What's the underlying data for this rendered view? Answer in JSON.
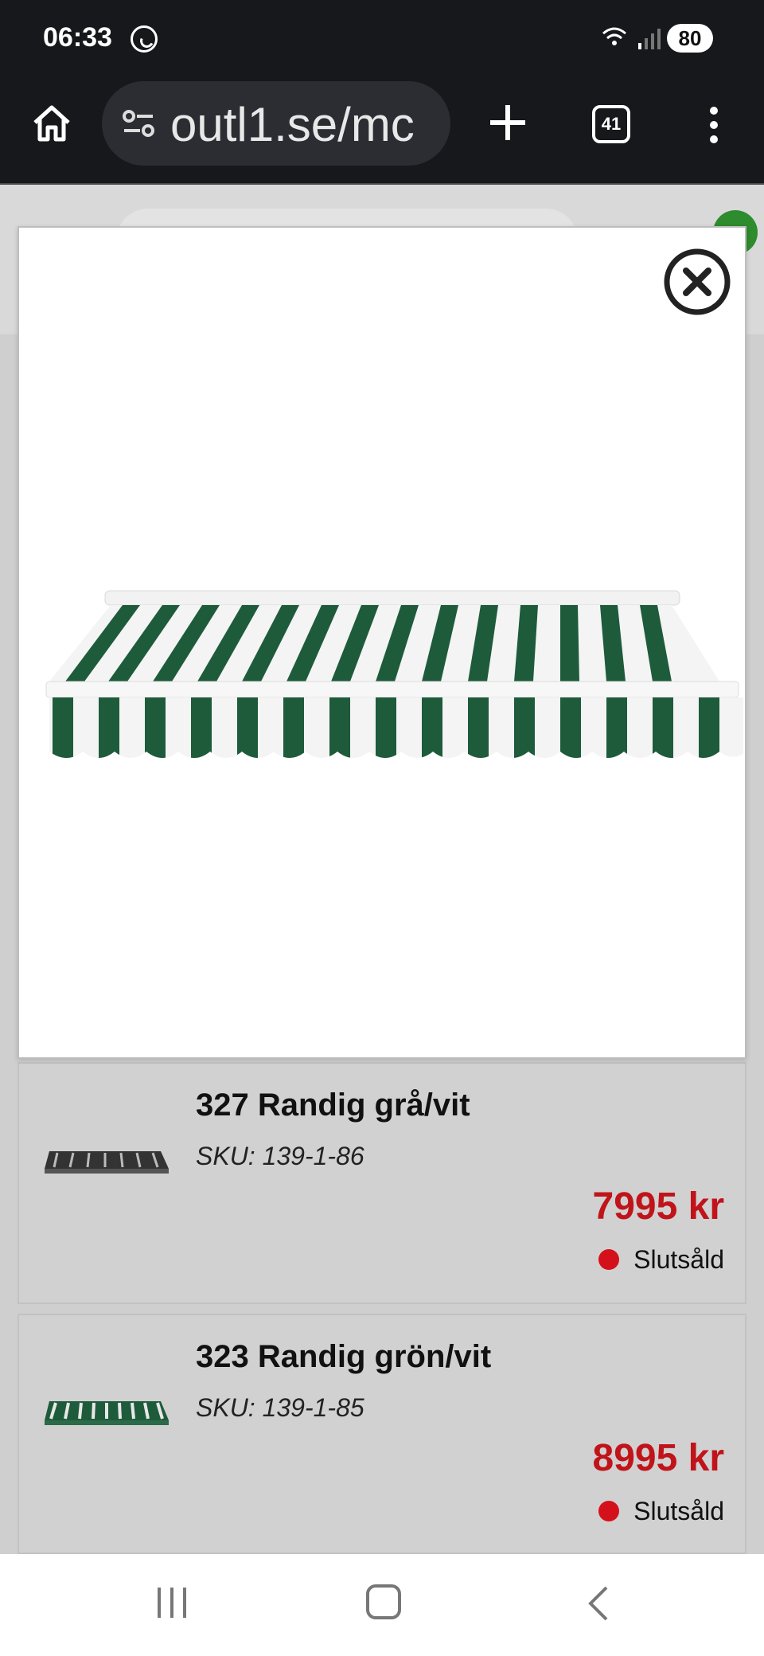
{
  "status_bar": {
    "time": "06:33",
    "battery": "80"
  },
  "browser": {
    "url": "outl1.se/mc",
    "tab_count": "41"
  },
  "products": [
    {
      "name": "327 Randig grå/vit",
      "sku": "SKU: 139-1-86",
      "price": "7995 kr",
      "stock": "Slutsåld"
    },
    {
      "name": "323 Randig grön/vit",
      "sku": "SKU: 139-1-85",
      "price": "8995 kr",
      "stock": "Slutsåld"
    }
  ],
  "colors": {
    "price": "#c0141a",
    "stock_dot": "#d4111a",
    "awning_green": "#1e5b3b"
  },
  "icons": {
    "home": "home-icon",
    "close": "close-circle-icon",
    "menu": "more-vert-icon"
  }
}
